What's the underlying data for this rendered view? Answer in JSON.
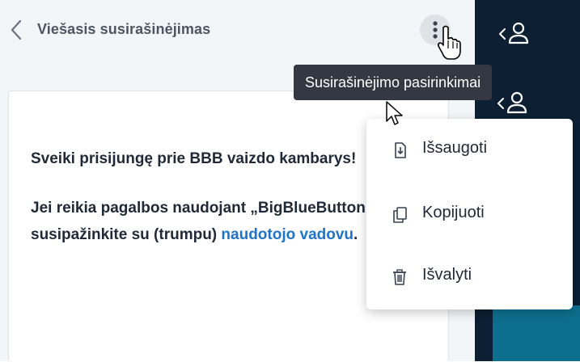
{
  "header": {
    "title": "Viešasis susirašinėjimas"
  },
  "tooltip": {
    "text": "Susirašinėjimo pasirinkimai"
  },
  "message": {
    "line1": "Sveiki prisijungę prie BBB vaizdo kambarys!",
    "line2_prefix": "Jei reikia pagalbos naudojant „BigBlueButton“, susipažinkite su (trumpu) ",
    "link_text": "naudotojo vadovu",
    "line2_suffix": "."
  },
  "options_menu": {
    "items": [
      {
        "label": "Išsaugoti",
        "icon": "download-icon"
      },
      {
        "label": "Kopijuoti",
        "icon": "copy-icon"
      },
      {
        "label": "Išvalyti",
        "icon": "trash-icon"
      }
    ]
  },
  "colors": {
    "sidebar": "#0c1f33",
    "accent_link": "#1e74c6",
    "tooltip_bg": "#333842",
    "teal": "#0d6f8e"
  }
}
